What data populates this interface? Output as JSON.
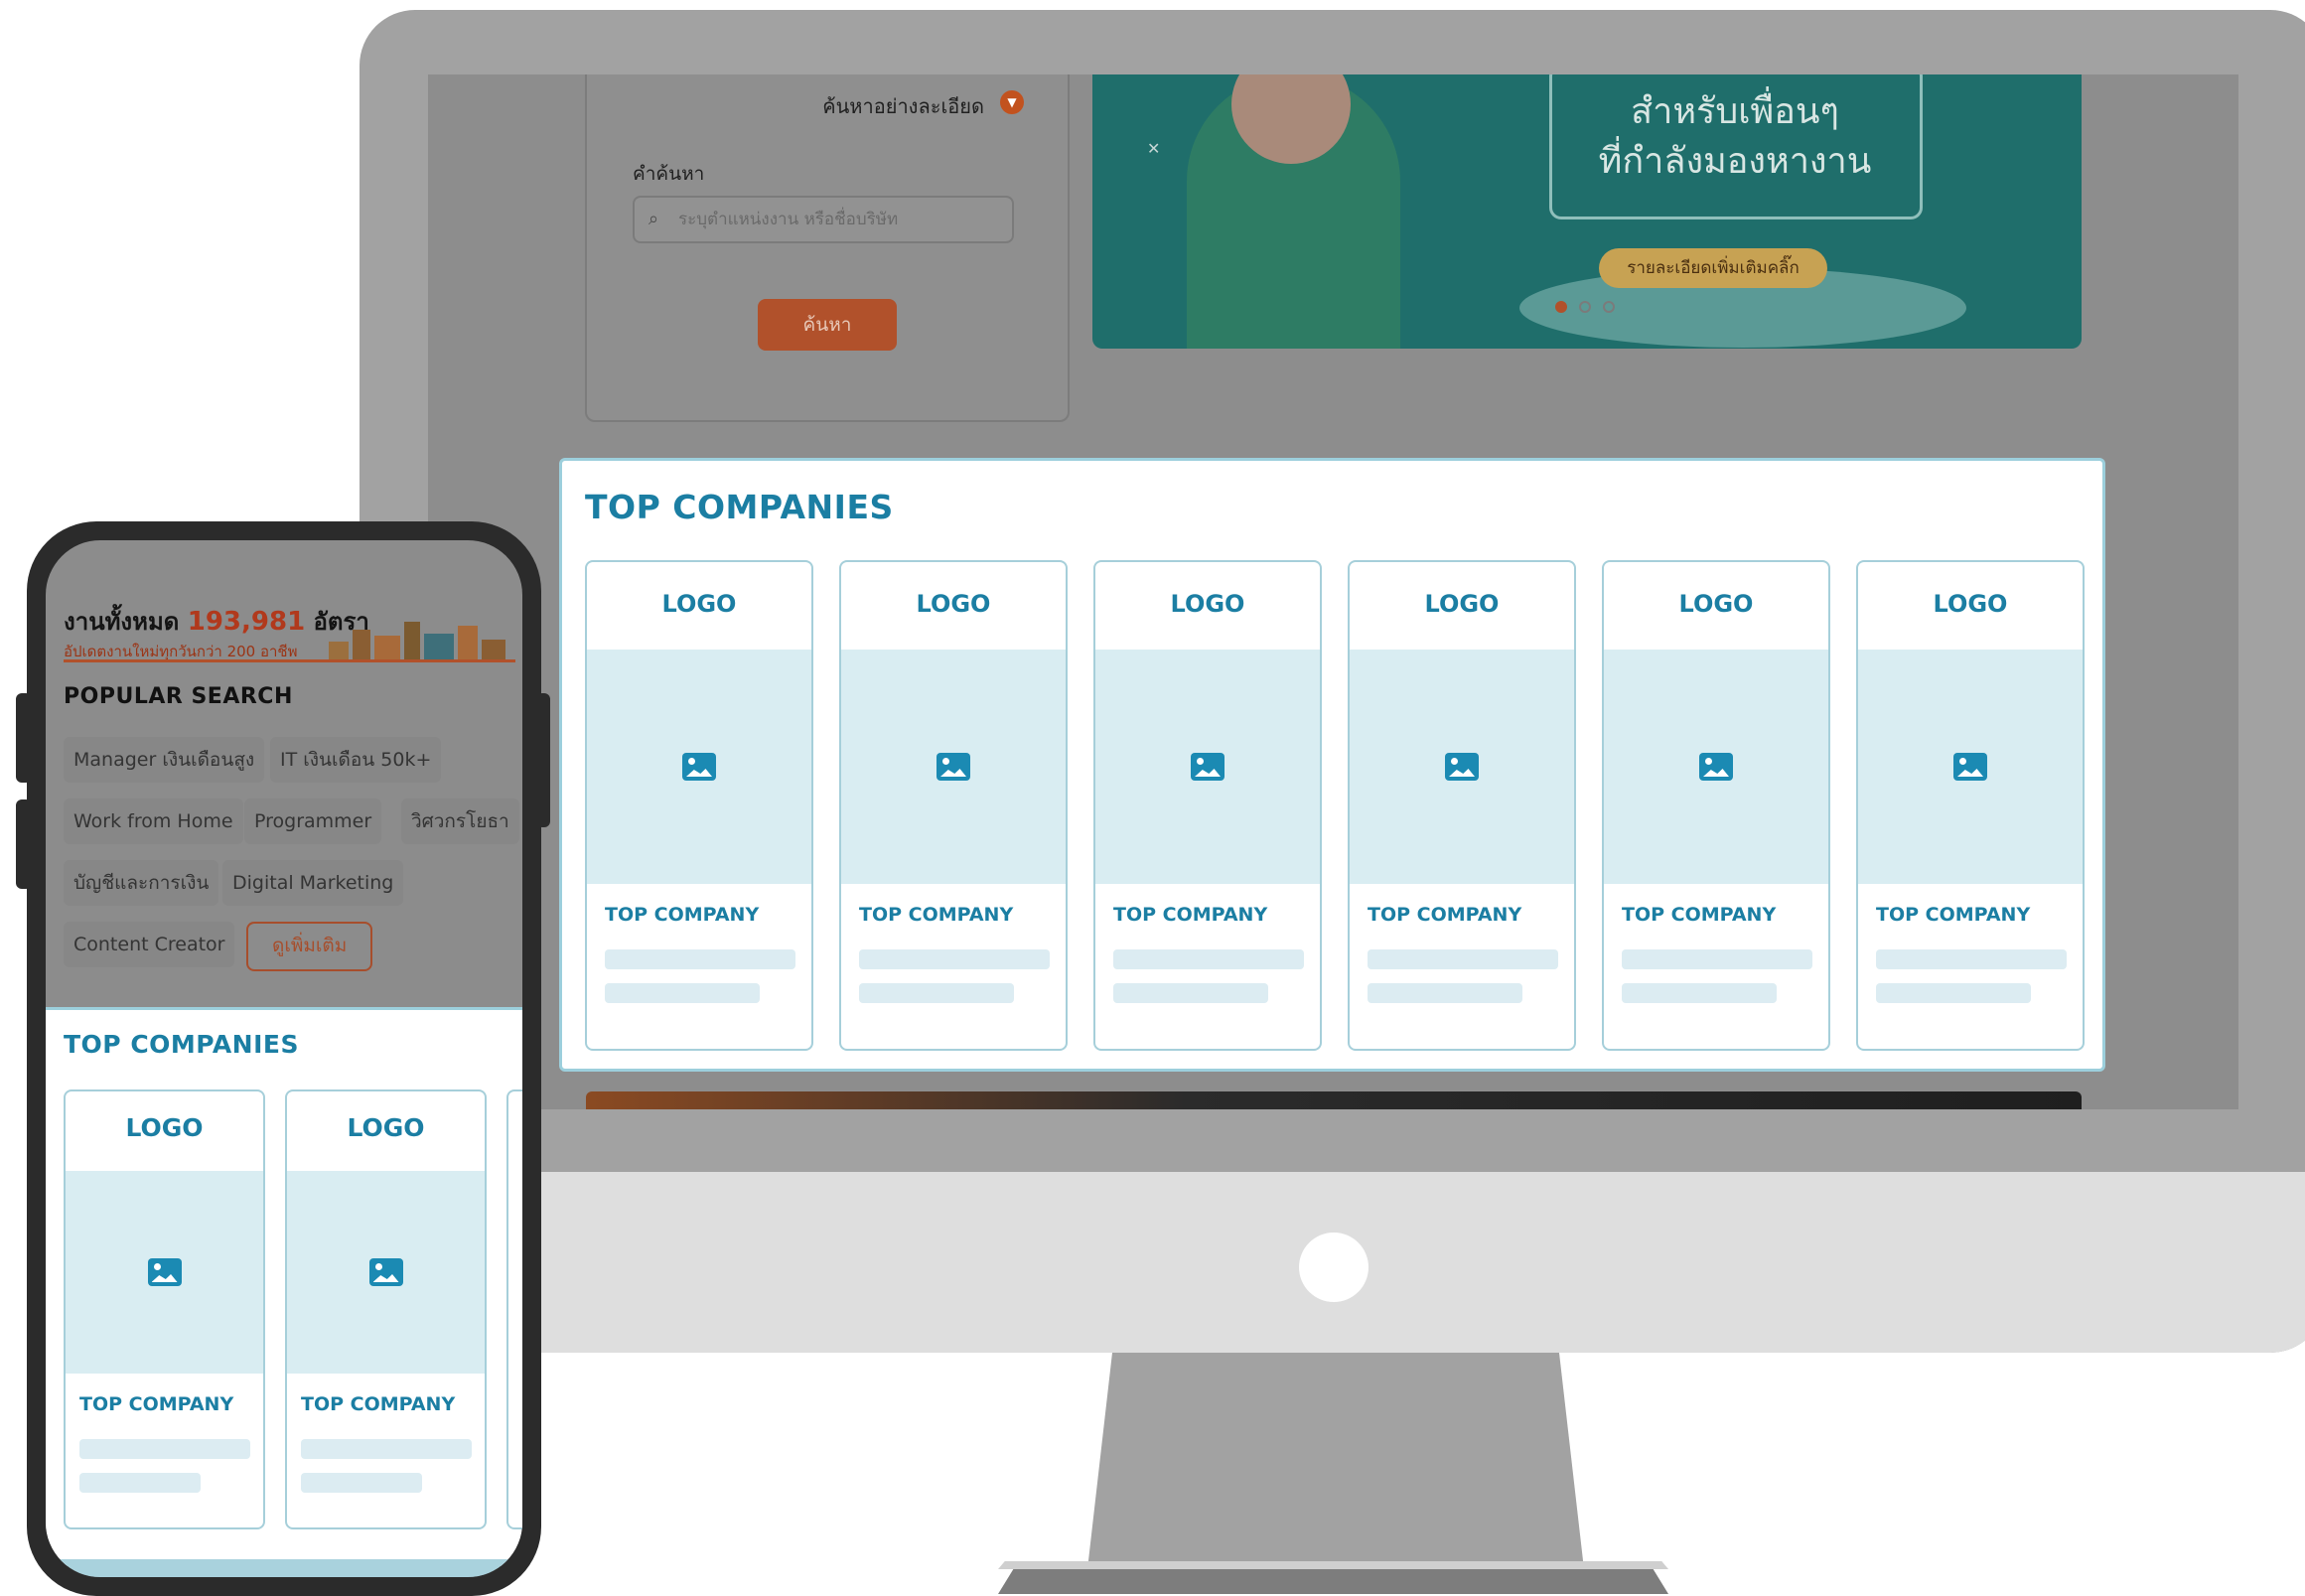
{
  "desktop": {
    "search": {
      "advanced_label": "ค้นหาอย่างละเอียด",
      "keyword_label": "คำค้นหา",
      "keyword_placeholder": "ระบุตำแหน่งงาน หรือชื่อบริษัท",
      "search_button": "ค้นหา"
    },
    "banner": {
      "line1": "สำหรับเพื่อนๆ",
      "line2": "ที่กำลังมองหางาน",
      "cta": "รายละเอียดเพิ่มเติมคลิ๊ก"
    },
    "carousel": {
      "total": 3,
      "active": 0
    },
    "top_companies": {
      "title": "TOP COMPANIES",
      "cards": [
        {
          "logo": "LOGO",
          "name": "TOP COMPANY"
        },
        {
          "logo": "LOGO",
          "name": "TOP COMPANY"
        },
        {
          "logo": "LOGO",
          "name": "TOP COMPANY"
        },
        {
          "logo": "LOGO",
          "name": "TOP COMPANY"
        },
        {
          "logo": "LOGO",
          "name": "TOP COMPANY"
        },
        {
          "logo": "LOGO",
          "name": "TOP COMPANY"
        }
      ]
    }
  },
  "mobile": {
    "job_count_prefix": "งานทั้งหมด",
    "job_count_value": "193,981",
    "job_count_suffix": "อัตรา",
    "job_count_sub": "อัปเดตงานใหม่ทุกวันกว่า 200 อาชีพ",
    "popular_title": "POPULAR SEARCH",
    "chips": [
      "Manager เงินเดือนสูง",
      "IT เงินเดือน 50k+",
      "Work from Home",
      "Programmer",
      "วิศวกรโยธา",
      "บัญชีและการเงิน",
      "Digital Marketing",
      "Content Creator"
    ],
    "more_button": "ดูเพิ่มเติม",
    "top_companies": {
      "title": "TOP COMPANIES",
      "cards": [
        {
          "logo": "LOGO",
          "name": "TOP COMPANY"
        },
        {
          "logo": "LOGO",
          "name": "TOP COMPANY"
        }
      ]
    }
  },
  "colors": {
    "accent_blue": "#1b7ea3",
    "accent_orange": "#b1512b",
    "light_blue": "#d9edf2"
  }
}
